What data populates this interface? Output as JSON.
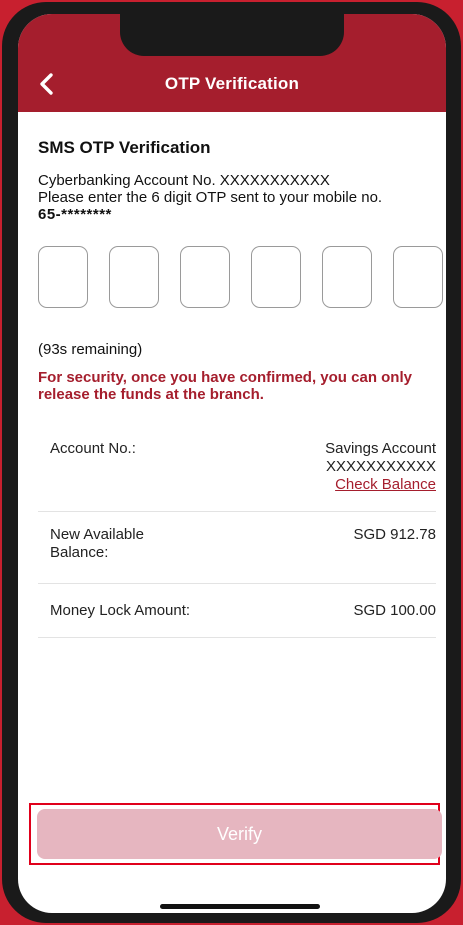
{
  "header": {
    "title": "OTP Verification",
    "back_icon": "chevron-left-icon"
  },
  "content": {
    "section_title": "SMS OTP Verification",
    "account_line": "Cyberbanking Account No. XXXXXXXXXXX",
    "instruction": "Please enter the 6 digit OTP sent to your mobile no.",
    "mobile": "65-********"
  },
  "otp": {
    "digits": [
      "",
      "",
      "",
      "",
      "",
      ""
    ]
  },
  "timer": "(93s remaining)",
  "warning": "For security, once you have confirmed, you can only release the funds at the branch.",
  "details": {
    "account_label": "Account No.:",
    "account_type": "Savings Account",
    "account_number": "XXXXXXXXXXX",
    "check_balance": "Check Balance",
    "balance_label": "New Available Balance:",
    "balance_value": "SGD 912.78",
    "lock_label": "Money Lock Amount:",
    "lock_value": "SGD 100.00"
  },
  "footer": {
    "verify_label": "Verify"
  },
  "colors": {
    "brand": "#a51e2d",
    "verify_disabled": "#e6b6c0"
  }
}
